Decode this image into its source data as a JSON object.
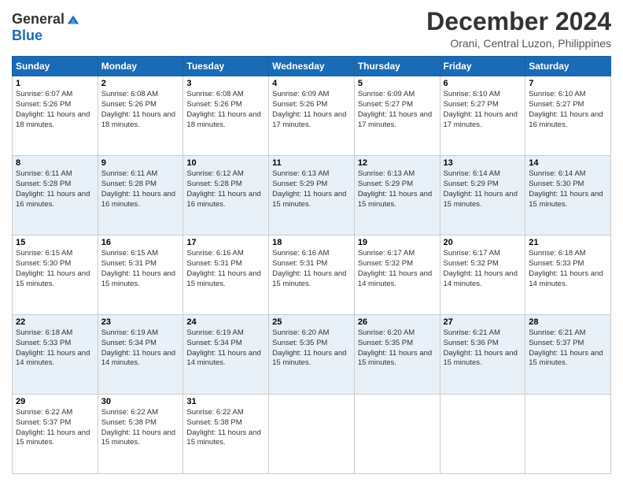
{
  "logo": {
    "general": "General",
    "blue": "Blue"
  },
  "title": "December 2024",
  "subtitle": "Orani, Central Luzon, Philippines",
  "days_of_week": [
    "Sunday",
    "Monday",
    "Tuesday",
    "Wednesday",
    "Thursday",
    "Friday",
    "Saturday"
  ],
  "weeks": [
    [
      {
        "day": "1",
        "sunrise": "6:07 AM",
        "sunset": "5:26 PM",
        "daylight": "11 hours and 18 minutes."
      },
      {
        "day": "2",
        "sunrise": "6:08 AM",
        "sunset": "5:26 PM",
        "daylight": "11 hours and 18 minutes."
      },
      {
        "day": "3",
        "sunrise": "6:08 AM",
        "sunset": "5:26 PM",
        "daylight": "11 hours and 18 minutes."
      },
      {
        "day": "4",
        "sunrise": "6:09 AM",
        "sunset": "5:26 PM",
        "daylight": "11 hours and 17 minutes."
      },
      {
        "day": "5",
        "sunrise": "6:09 AM",
        "sunset": "5:27 PM",
        "daylight": "11 hours and 17 minutes."
      },
      {
        "day": "6",
        "sunrise": "6:10 AM",
        "sunset": "5:27 PM",
        "daylight": "11 hours and 17 minutes."
      },
      {
        "day": "7",
        "sunrise": "6:10 AM",
        "sunset": "5:27 PM",
        "daylight": "11 hours and 16 minutes."
      }
    ],
    [
      {
        "day": "8",
        "sunrise": "6:11 AM",
        "sunset": "5:28 PM",
        "daylight": "11 hours and 16 minutes."
      },
      {
        "day": "9",
        "sunrise": "6:11 AM",
        "sunset": "5:28 PM",
        "daylight": "11 hours and 16 minutes."
      },
      {
        "day": "10",
        "sunrise": "6:12 AM",
        "sunset": "5:28 PM",
        "daylight": "11 hours and 16 minutes."
      },
      {
        "day": "11",
        "sunrise": "6:13 AM",
        "sunset": "5:29 PM",
        "daylight": "11 hours and 15 minutes."
      },
      {
        "day": "12",
        "sunrise": "6:13 AM",
        "sunset": "5:29 PM",
        "daylight": "11 hours and 15 minutes."
      },
      {
        "day": "13",
        "sunrise": "6:14 AM",
        "sunset": "5:29 PM",
        "daylight": "11 hours and 15 minutes."
      },
      {
        "day": "14",
        "sunrise": "6:14 AM",
        "sunset": "5:30 PM",
        "daylight": "11 hours and 15 minutes."
      }
    ],
    [
      {
        "day": "15",
        "sunrise": "6:15 AM",
        "sunset": "5:30 PM",
        "daylight": "11 hours and 15 minutes."
      },
      {
        "day": "16",
        "sunrise": "6:15 AM",
        "sunset": "5:31 PM",
        "daylight": "11 hours and 15 minutes."
      },
      {
        "day": "17",
        "sunrise": "6:16 AM",
        "sunset": "5:31 PM",
        "daylight": "11 hours and 15 minutes."
      },
      {
        "day": "18",
        "sunrise": "6:16 AM",
        "sunset": "5:31 PM",
        "daylight": "11 hours and 15 minutes."
      },
      {
        "day": "19",
        "sunrise": "6:17 AM",
        "sunset": "5:32 PM",
        "daylight": "11 hours and 14 minutes."
      },
      {
        "day": "20",
        "sunrise": "6:17 AM",
        "sunset": "5:32 PM",
        "daylight": "11 hours and 14 minutes."
      },
      {
        "day": "21",
        "sunrise": "6:18 AM",
        "sunset": "5:33 PM",
        "daylight": "11 hours and 14 minutes."
      }
    ],
    [
      {
        "day": "22",
        "sunrise": "6:18 AM",
        "sunset": "5:33 PM",
        "daylight": "11 hours and 14 minutes."
      },
      {
        "day": "23",
        "sunrise": "6:19 AM",
        "sunset": "5:34 PM",
        "daylight": "11 hours and 14 minutes."
      },
      {
        "day": "24",
        "sunrise": "6:19 AM",
        "sunset": "5:34 PM",
        "daylight": "11 hours and 14 minutes."
      },
      {
        "day": "25",
        "sunrise": "6:20 AM",
        "sunset": "5:35 PM",
        "daylight": "11 hours and 15 minutes."
      },
      {
        "day": "26",
        "sunrise": "6:20 AM",
        "sunset": "5:35 PM",
        "daylight": "11 hours and 15 minutes."
      },
      {
        "day": "27",
        "sunrise": "6:21 AM",
        "sunset": "5:36 PM",
        "daylight": "11 hours and 15 minutes."
      },
      {
        "day": "28",
        "sunrise": "6:21 AM",
        "sunset": "5:37 PM",
        "daylight": "11 hours and 15 minutes."
      }
    ],
    [
      {
        "day": "29",
        "sunrise": "6:22 AM",
        "sunset": "5:37 PM",
        "daylight": "11 hours and 15 minutes."
      },
      {
        "day": "30",
        "sunrise": "6:22 AM",
        "sunset": "5:38 PM",
        "daylight": "11 hours and 15 minutes."
      },
      {
        "day": "31",
        "sunrise": "6:22 AM",
        "sunset": "5:38 PM",
        "daylight": "11 hours and 15 minutes."
      },
      null,
      null,
      null,
      null
    ]
  ]
}
